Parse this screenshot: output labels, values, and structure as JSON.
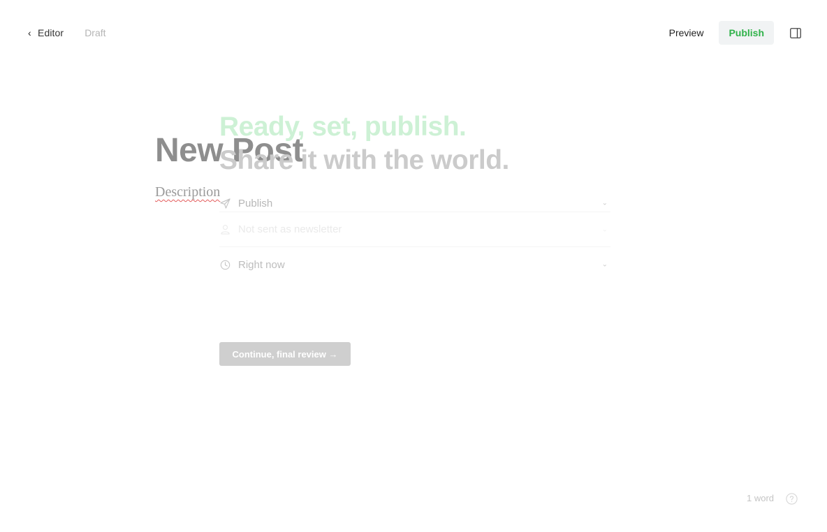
{
  "topbar": {
    "back_label": "Editor",
    "status": "Draft",
    "preview_label": "Preview",
    "publish_label": "Publish"
  },
  "post": {
    "title": "New Post",
    "description_placeholder": "Description"
  },
  "publish_flow": {
    "heading_line1": "Ready, set, publish.",
    "heading_line2": "Share it with the world.",
    "options": [
      {
        "icon": "send-icon",
        "label": "Publish"
      },
      {
        "icon": "user-icon",
        "label": "Not sent as newsletter"
      },
      {
        "icon": "clock-icon",
        "label": "Right now"
      }
    ],
    "continue_label": "Continue, final review →"
  },
  "footer": {
    "word_count": "1 word"
  },
  "colors": {
    "accent_green": "#30b24a",
    "heading_green_faded": "#cdf1d5",
    "button_disabled": "#cfcfcf"
  }
}
